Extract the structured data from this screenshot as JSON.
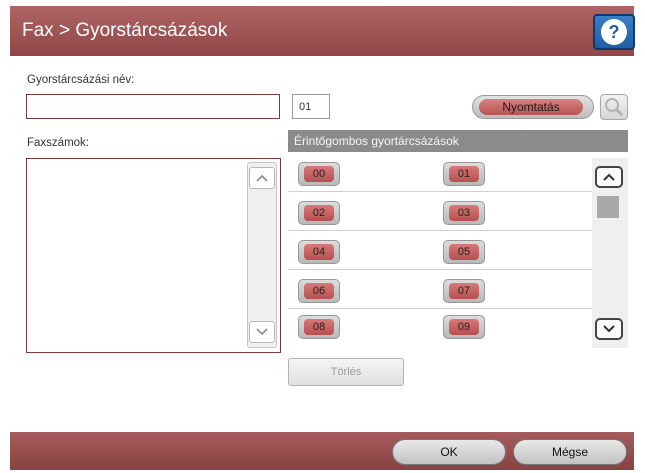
{
  "header": {
    "title": "Fax > Gyorstárcsázások",
    "help_icon": "question-mark-icon",
    "help_label": "?"
  },
  "form": {
    "name_label": "Gyorstárcsázási név:",
    "name_value": "",
    "number_value": "01",
    "print_label": "Nyomtatás",
    "fax_numbers_label": "Faxszámok:",
    "fax_numbers": []
  },
  "speed_dial": {
    "header": "Érintőgombos gyortárcsázások",
    "rows": [
      [
        "00",
        "01"
      ],
      [
        "02",
        "03"
      ],
      [
        "04",
        "05"
      ],
      [
        "06",
        "07"
      ],
      [
        "08",
        "09"
      ]
    ]
  },
  "buttons": {
    "delete": "Törlés",
    "ok": "OK",
    "cancel": "Mégse"
  },
  "scroll": {
    "up_glyph": "▲",
    "down_glyph": "▼",
    "list_up": "^",
    "list_down": "v"
  },
  "colors": {
    "accent": "#9c5050",
    "help": "#2a6cb6"
  }
}
